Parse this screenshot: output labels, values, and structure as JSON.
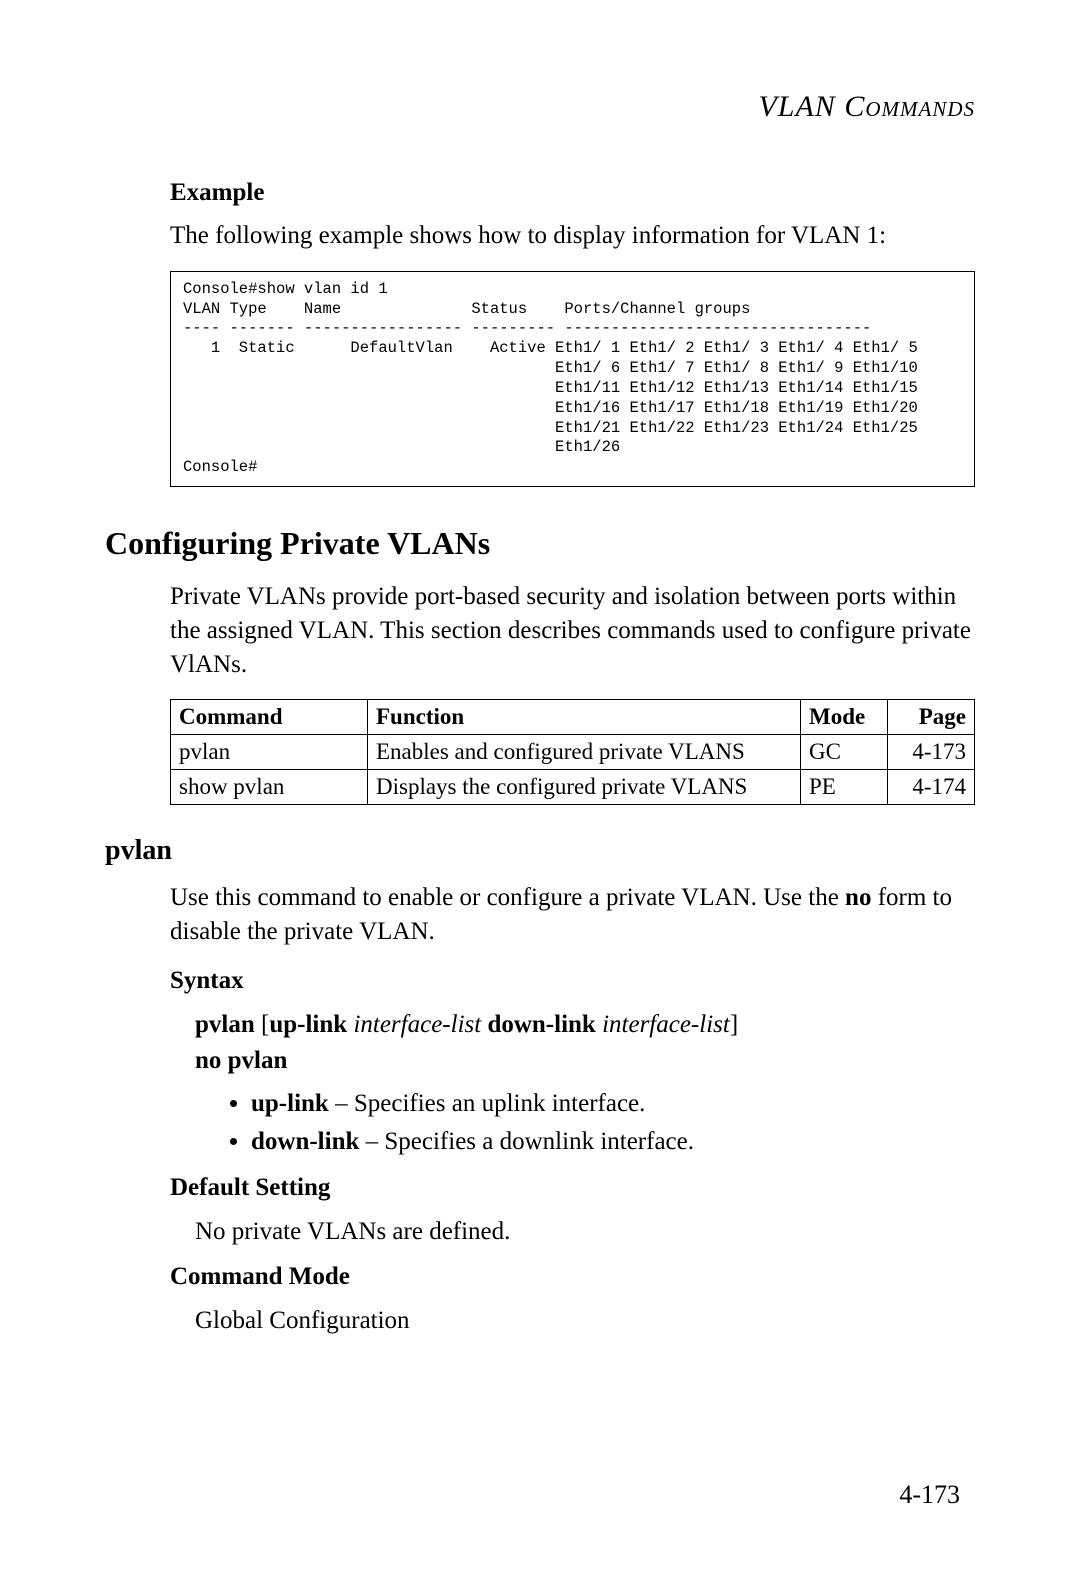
{
  "header": {
    "title_italic": "VLAN",
    "title_sc": " Commands"
  },
  "example": {
    "heading": "Example",
    "intro": "The following example shows how to display information for VLAN 1:",
    "console": "Console#show vlan id 1\nVLAN Type    Name              Status    Ports/Channel groups\n---- ------- ----------------- --------- ---------------------------------\n   1  Static      DefaultVlan    Active Eth1/ 1 Eth1/ 2 Eth1/ 3 Eth1/ 4 Eth1/ 5\n                                        Eth1/ 6 Eth1/ 7 Eth1/ 8 Eth1/ 9 Eth1/10\n                                        Eth1/11 Eth1/12 Eth1/13 Eth1/14 Eth1/15\n                                        Eth1/16 Eth1/17 Eth1/18 Eth1/19 Eth1/20\n                                        Eth1/21 Eth1/22 Eth1/23 Eth1/24 Eth1/25\n                                        Eth1/26\nConsole#"
  },
  "cfg": {
    "heading": "Configuring Private VLANs",
    "intro": "Private VLANs provide port-based security and isolation between ports within the assigned VLAN. This section describes commands used to configure private VlANs.",
    "table": {
      "headers": {
        "c1": "Command",
        "c2": "Function",
        "c3": "Mode",
        "c4": "Page"
      },
      "rows": [
        {
          "c1": "pvlan",
          "c2": "Enables and configured private VLANS",
          "c3": "GC",
          "c4": "4-173"
        },
        {
          "c1": "show pvlan",
          "c2": "Displays the configured private VLANS",
          "c3": "PE",
          "c4": "4-174"
        }
      ]
    }
  },
  "pvlan": {
    "heading": "pvlan",
    "intro_a": "Use this command to enable or configure a private VLAN. Use the ",
    "intro_b": "no",
    "intro_c": " form to disable the private VLAN.",
    "syntax_h": "Syntax",
    "syntax": {
      "l1_b1": "pvlan ",
      "l1_t1": "[",
      "l1_b2": "up-link ",
      "l1_i1": "interface-list ",
      "l1_b3": "down-link ",
      "l1_i2": "interface-list",
      "l1_t2": "]",
      "l2": "no pvlan"
    },
    "bullets": [
      {
        "b": "up-link",
        "t": " – Specifies an uplink interface."
      },
      {
        "b": "down-link",
        "t": " – Specifies a downlink interface."
      }
    ],
    "default_h": "Default Setting",
    "default_t": "No private VLANs are defined.",
    "mode_h": "Command Mode",
    "mode_t": "Global Configuration"
  },
  "page_number": "4-173"
}
